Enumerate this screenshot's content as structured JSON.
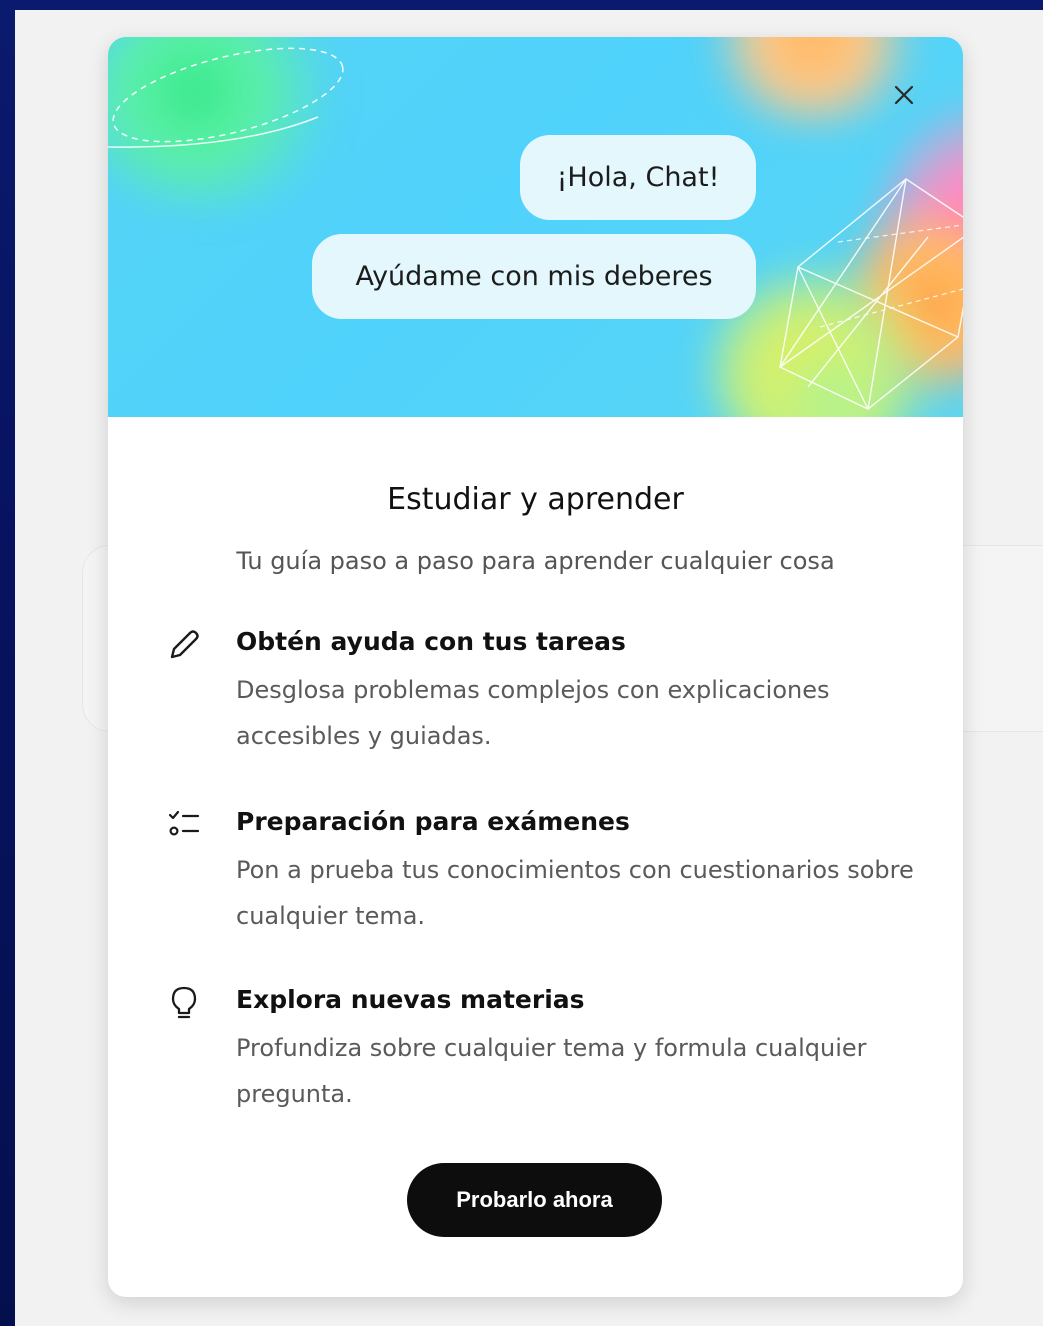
{
  "hero": {
    "bubble_1": "¡Hola, Chat!",
    "bubble_2": "Ayúdame con mis deberes",
    "close_icon": "close-icon"
  },
  "title": "Estudiar y aprender",
  "subtitle": "Tu guía paso a paso para aprender cualquier cosa",
  "features": [
    {
      "icon": "pencil-icon",
      "title": "Obtén ayuda con tus tareas",
      "description": "Desglosa problemas complejos con explicaciones accesibles y guiadas."
    },
    {
      "icon": "checklist-icon",
      "title": "Preparación para exámenes",
      "description": "Pon a prueba tus conocimientos con cuestionarios sobre cualquier tema."
    },
    {
      "icon": "lightbulb-icon",
      "title": "Explora nuevas materias",
      "description": "Profundiza sobre cualquier tema y formula cualquier pregunta."
    }
  ],
  "cta_label": "Probarlo ahora",
  "colors": {
    "page_background": "#071360",
    "app_background": "#f2f2f2",
    "hero_background": "#4fd2fb",
    "bubble_background": "#e3f7fc",
    "cta_background": "#0d0d0d",
    "cta_text": "#ffffff"
  }
}
